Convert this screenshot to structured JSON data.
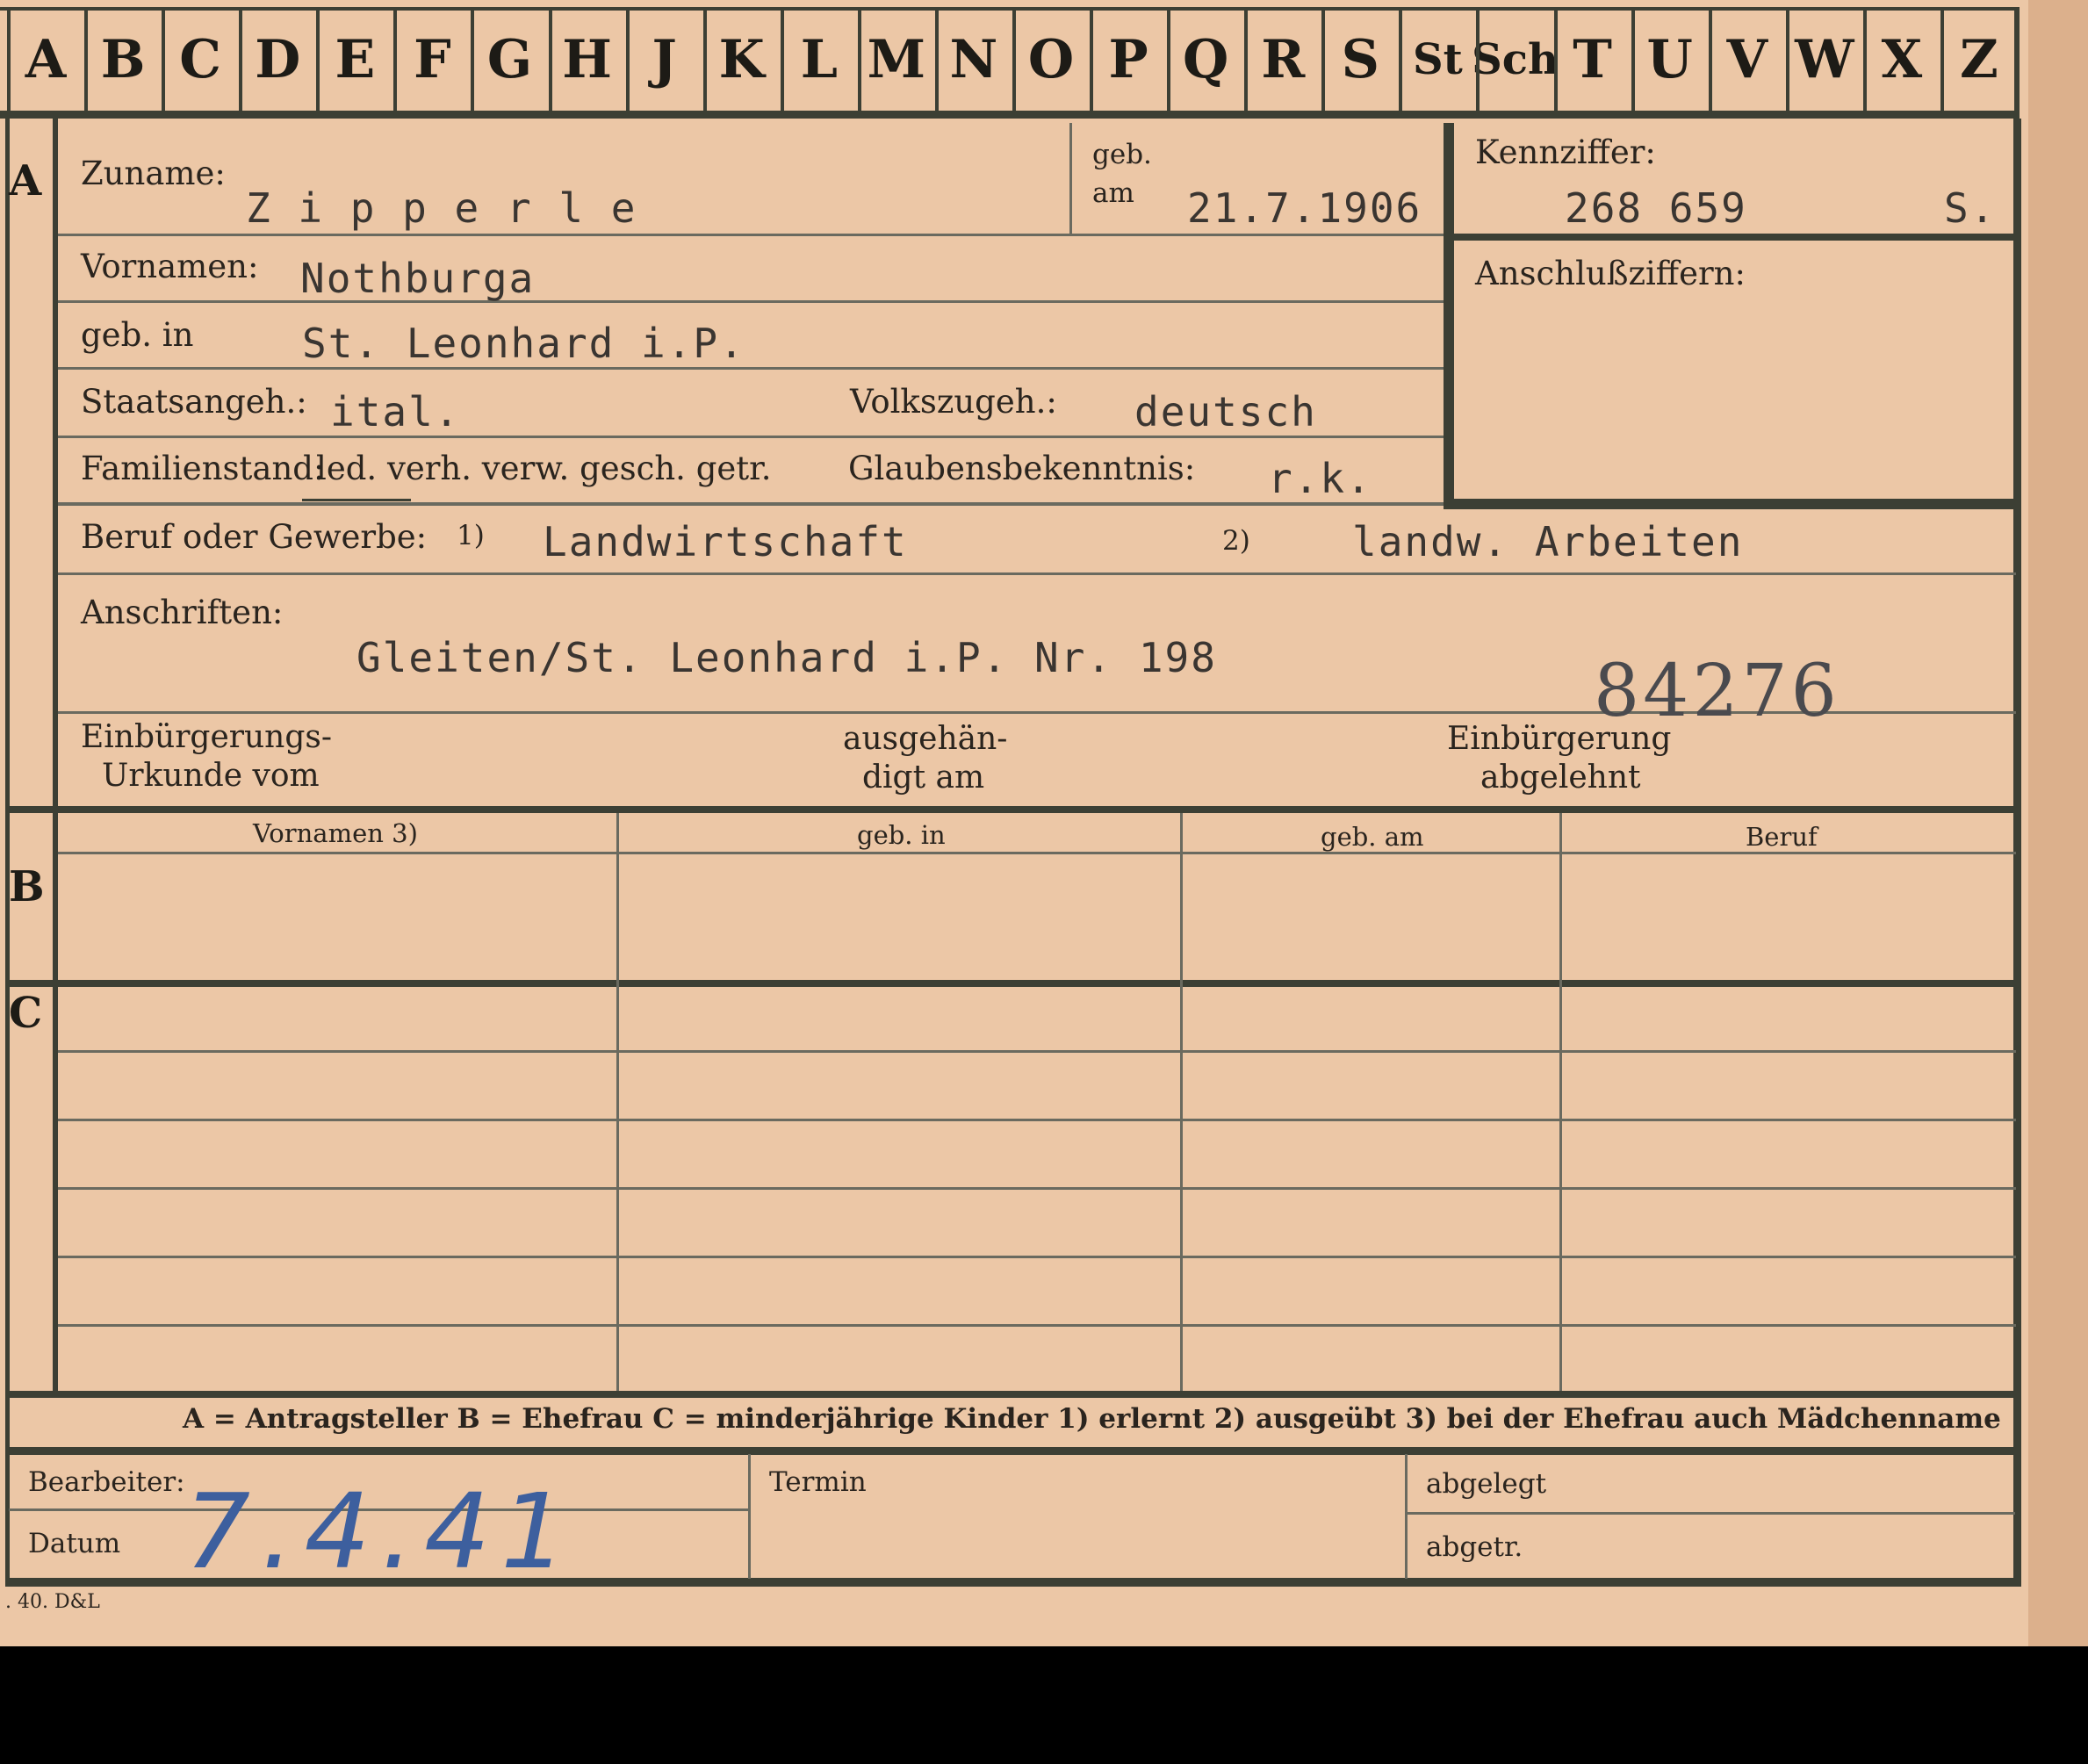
{
  "alphabet": [
    "A",
    "B",
    "C",
    "D",
    "E",
    "F",
    "G",
    "H",
    "J",
    "K",
    "L",
    "M",
    "N",
    "O",
    "P",
    "Q",
    "R",
    "S",
    "St",
    "Sch",
    "T",
    "U",
    "V",
    "W",
    "X",
    "Z"
  ],
  "sections": [
    "A",
    "B",
    "C"
  ],
  "person": {
    "zuname_label": "Zuname:",
    "zuname": "Z i p p e r l e",
    "geb_label": "geb.",
    "am_label": "am",
    "geb_am": "21.7.1906",
    "kennziffer_label": "Kennziffer:",
    "kennziffer": "268 659",
    "kennziffer_suffix": "S.",
    "anschluss_label": "Anschlußziffern:",
    "vornamen_label": "Vornamen:",
    "vornamen": "Nothburga",
    "geb_in_label": "geb. in",
    "geb_in": "St. Leonhard i.P.",
    "staat_label": "Staatsangeh.:",
    "staat": "ital.",
    "volk_label": "Volkszugeh.:",
    "volk": "deutsch",
    "familienstand_label": "Familienstand:",
    "familienstand_options": "led. verh. verw. gesch. getr.",
    "glauben_label": "Glaubensbekenntnis:",
    "glauben": "r.k.",
    "beruf_label": "Beruf oder Gewerbe:",
    "beruf_mark1": "1)",
    "beruf1": "Landwirtschaft",
    "beruf_mark2": "2)",
    "beruf2": "landw. Arbeiten",
    "anschriften_label": "Anschriften:",
    "anschrift": "Gleiten/St. Leonhard i.P. Nr. 198",
    "stamp_number": "84276",
    "einb_urkunde_l1": "Einbürgerungs-",
    "einb_urkunde_l2": "Urkunde vom",
    "ausgeh_l1": "ausgehän-",
    "ausgeh_l2": "digt am",
    "einb_abgel_l1": "Einbürgerung",
    "einb_abgel_l2": "abgelehnt"
  },
  "table_headers": [
    "Vornamen 3)",
    "geb. in",
    "geb. am",
    "Beruf"
  ],
  "legend": "A = Antragsteller   B = Ehefrau   C = minderjährige Kinder   1) erlernt   2) ausgeübt   3) bei der Ehefrau auch Mädchenname",
  "footer": {
    "bearbeiter_label": "Bearbeiter:",
    "datum_label": "Datum",
    "datum_hand": "7.4.41",
    "termin_label": "Termin",
    "abgelegt_label": "abgelegt",
    "abgetr_label": "abgetr.",
    "print_code": ". 40. D&L"
  }
}
